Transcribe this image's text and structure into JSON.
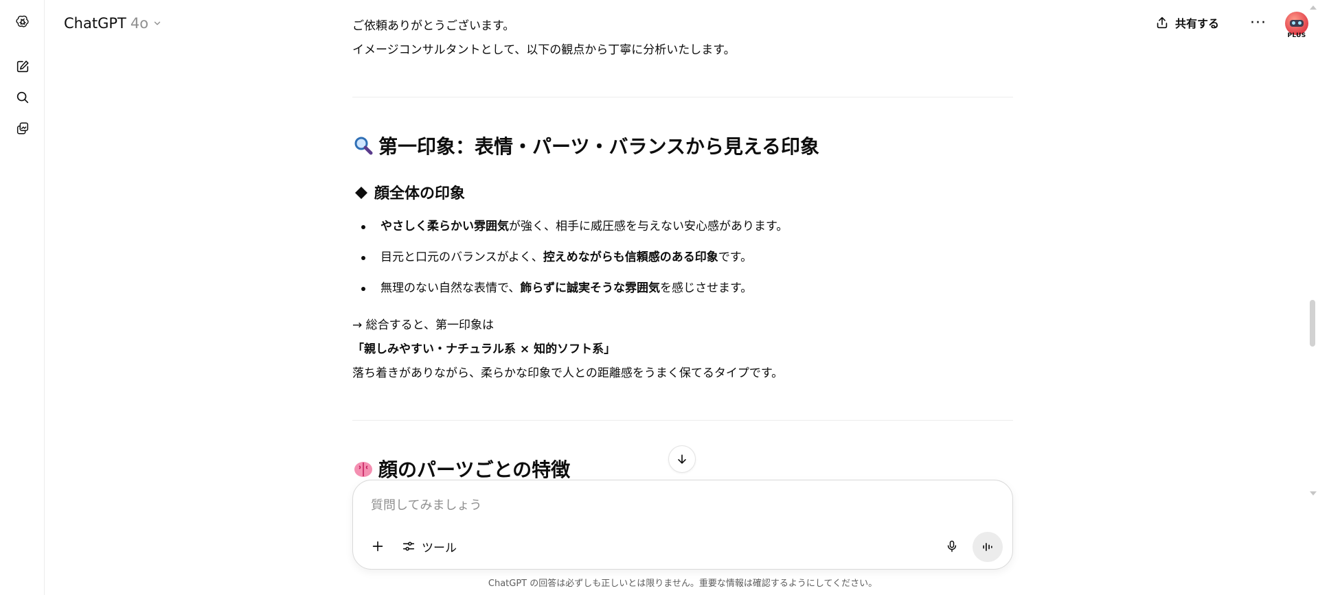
{
  "header": {
    "model_name": "ChatGPT",
    "model_version": "4o",
    "share_label": "共有する",
    "more_label": "···",
    "plus_badge": "PLUS"
  },
  "message": {
    "intro_1": "ご依頼ありがとうございます。",
    "intro_2": "イメージコンサルタントとして、以下の観点から丁寧に分析いたします。",
    "section1": {
      "title": "第一印象：表情・パーツ・バランスから見える印象",
      "subsection_title": "顔全体の印象",
      "bullets": [
        {
          "bold": "やさしく柔らかい雰囲気",
          "pre": "",
          "post": "が強く、相手に威圧感を与えない安心感があります。"
        },
        {
          "pre": "目元と口元のバランスがよく、",
          "bold": "控えめながらも信頼感のある印象",
          "post": "です。"
        },
        {
          "pre": "無理のない自然な表情で、",
          "bold": "飾らずに誠実そうな雰囲気",
          "post": "を感じさせます。"
        }
      ],
      "summary_1": "→ 総合すると、第一印象は",
      "summary_2": "「親しみやすい・ナチュラル系 × 知的ソフト系」",
      "summary_3": "落ち着きがありながら、柔らかな印象で人との距離感をうまく保てるタイプです。"
    },
    "section2": {
      "title": "顔のパーツごとの特徴"
    }
  },
  "composer": {
    "placeholder": "質問してみましょう",
    "tools_label": "ツール"
  },
  "footer": {
    "disclaimer": "ChatGPT の回答は必ずしも正しいとは限りません。重要な情報は確認するようにしてください。"
  },
  "colors": {
    "text": "#0d0d0d",
    "muted": "#8f8f8f",
    "divider": "#ececec",
    "avatar": "#e1404a"
  },
  "icons": {
    "logo": "openai-logo-icon",
    "new_chat": "new-chat-icon",
    "search": "search-icon",
    "library": "library-icon",
    "section1": "magnifying-glass-emoji",
    "subsection": "black-diamond-icon",
    "section2": "brain-emoji"
  }
}
